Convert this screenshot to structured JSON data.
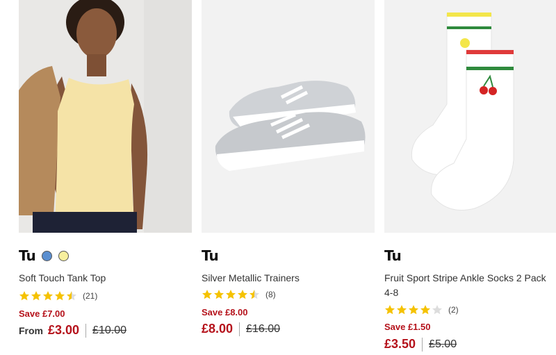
{
  "products": [
    {
      "brand": "Tu",
      "title": "Soft Touch Tank Top",
      "swatches": [
        "#5b8fd0",
        "#f7ef9e"
      ],
      "rating": 4.5,
      "reviews": "(21)",
      "save": "Save £7.00",
      "from": "From",
      "price": "£3.00",
      "was": "£10.00"
    },
    {
      "brand": "Tu",
      "title": "Silver Metallic Trainers",
      "swatches": [],
      "rating": 4.5,
      "reviews": "(8)",
      "save": "Save £8.00",
      "from": "",
      "price": "£8.00",
      "was": "£16.00"
    },
    {
      "brand": "Tu",
      "title": "Fruit Sport Stripe Ankle Socks 2 Pack 4-8",
      "swatches": [],
      "rating": 4,
      "reviews": "(2)",
      "save": "Save £1.50",
      "from": "",
      "price": "£3.50",
      "was": "£5.00"
    }
  ],
  "colors": {
    "star": "#f5c200",
    "star_empty": "#dddddd",
    "sale": "#b5121b"
  }
}
